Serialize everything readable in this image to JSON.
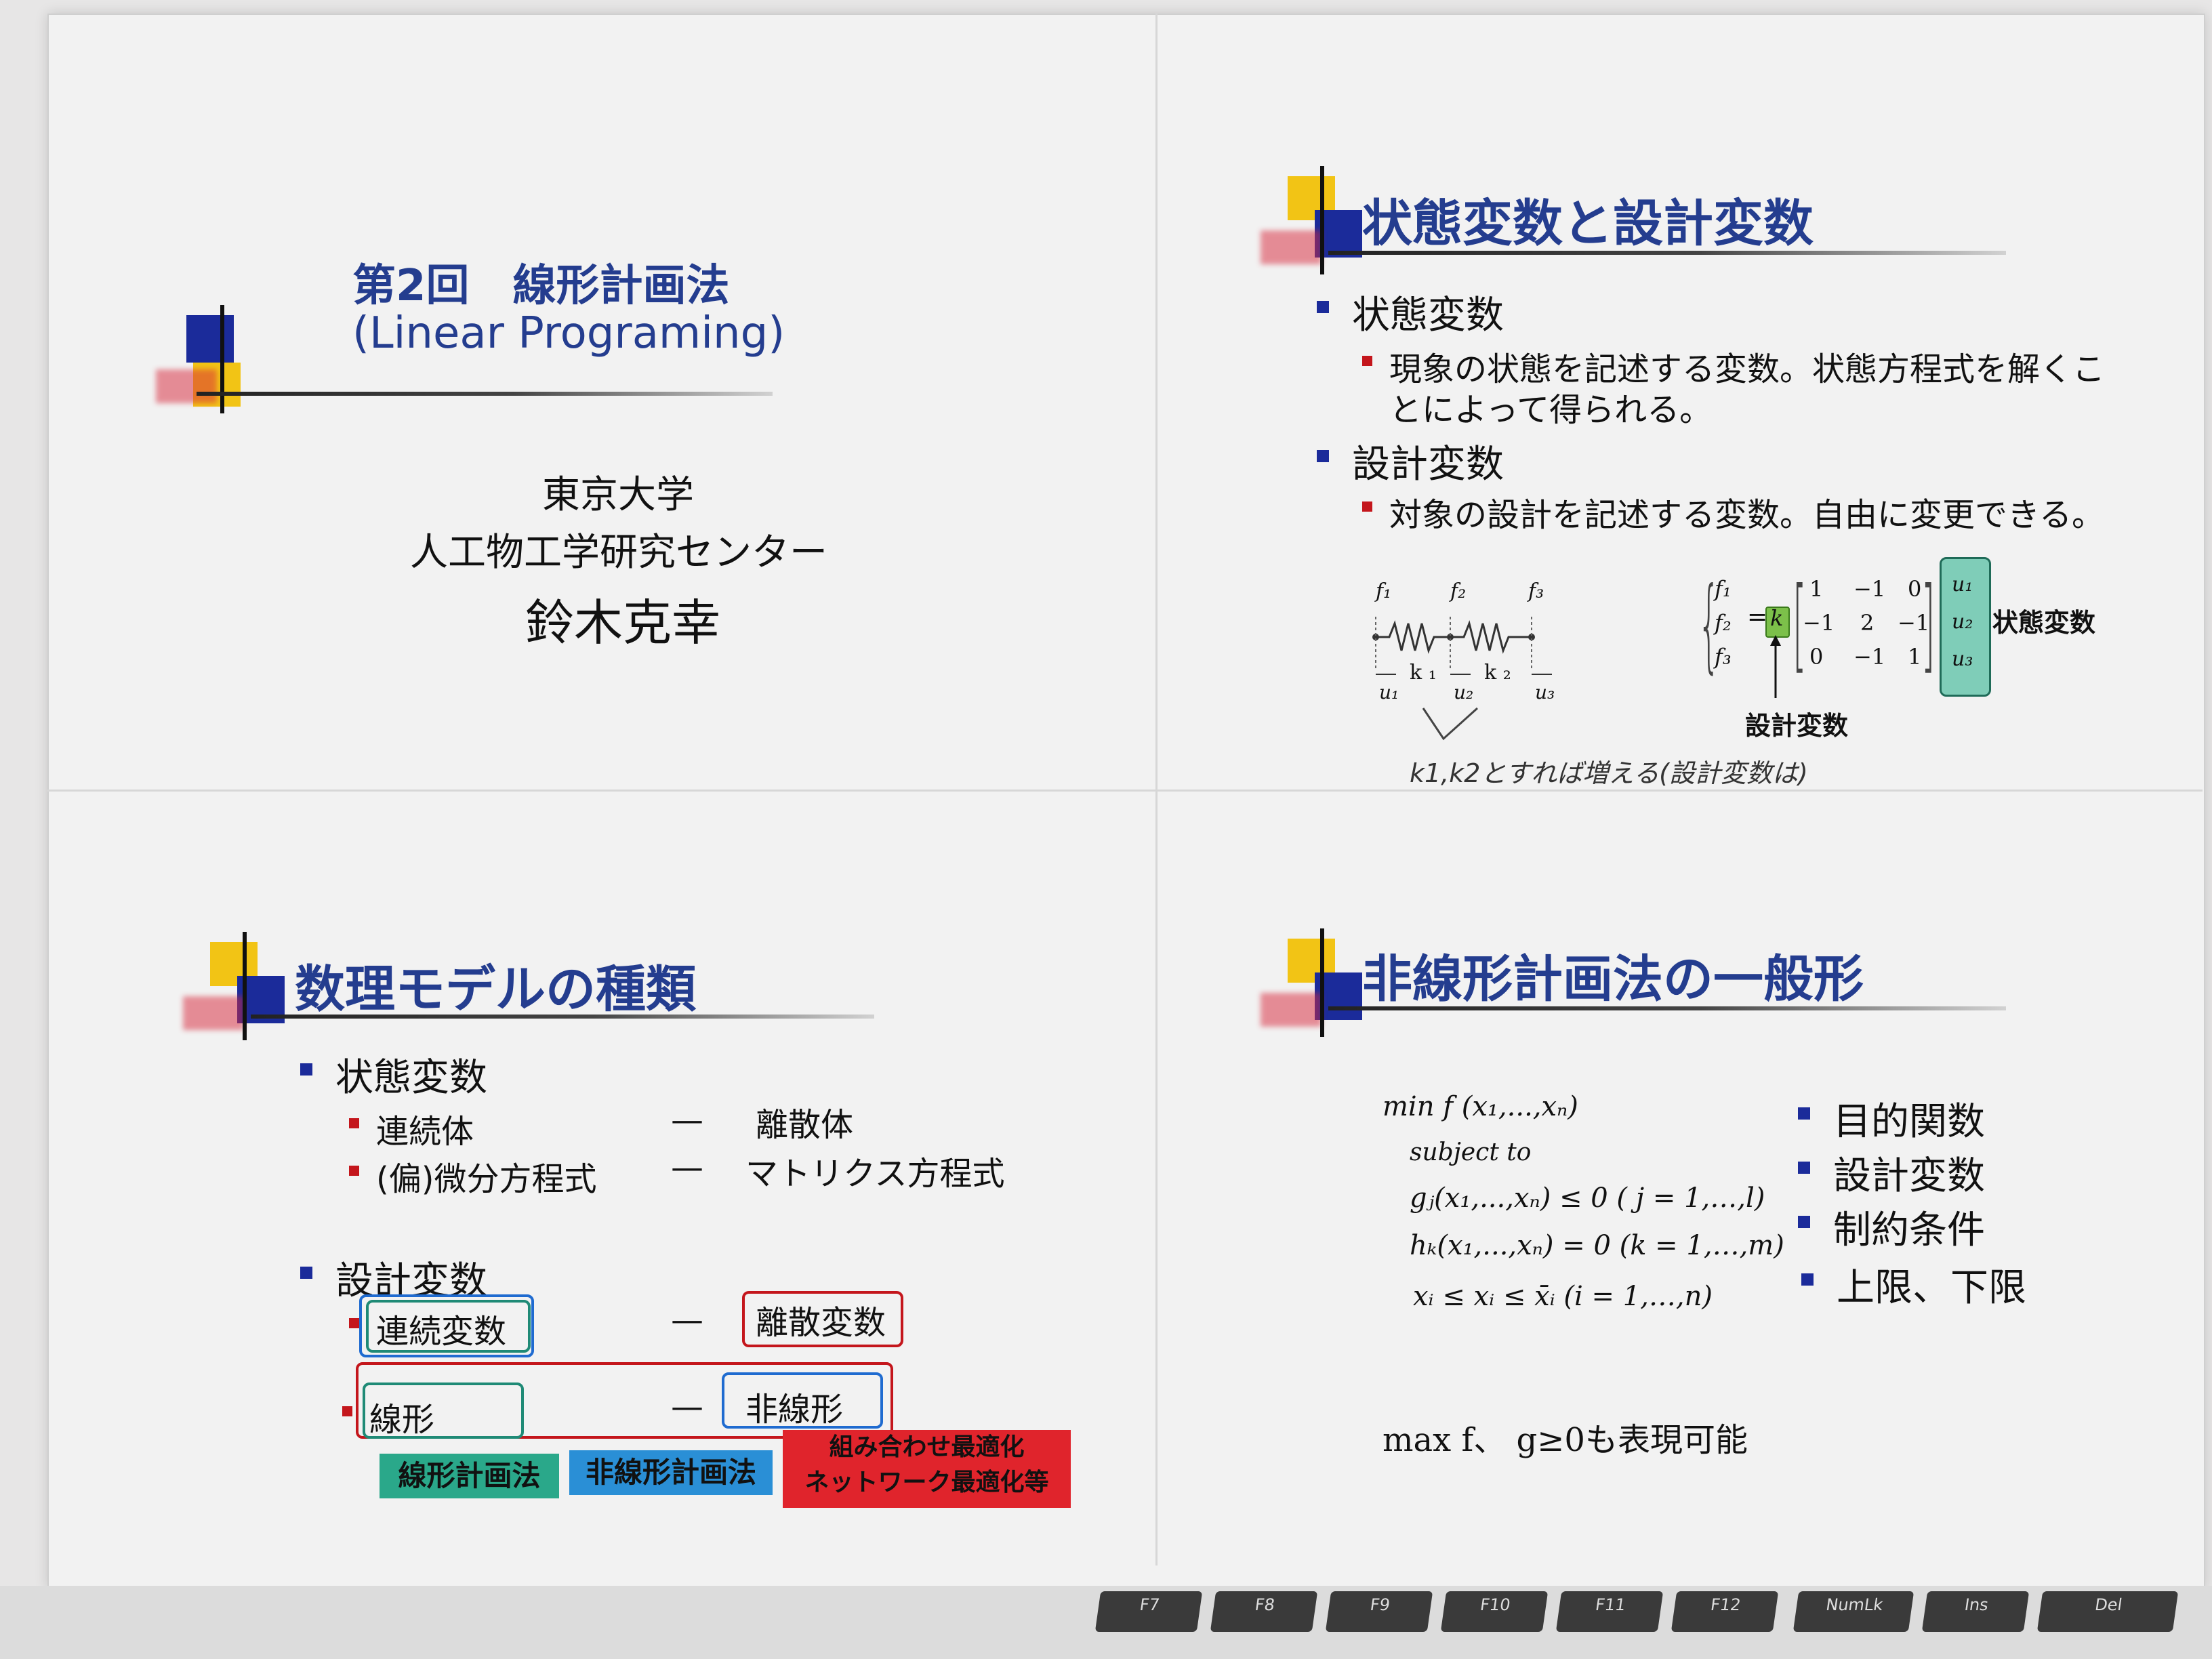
{
  "slide1": {
    "title_line1": "第2回　線形計画法",
    "title_line2": "(Linear Programing)",
    "affiliation1": "東京大学",
    "affiliation2": "人工物工学研究センター",
    "author": "鈴木克幸"
  },
  "slide2": {
    "title": "状態変数と設計変数",
    "bullet1": "状態変数",
    "sub1_line1": "現象の状態を記述する変数。状態方程式を解くこ",
    "sub1_line2": "とによって得られる。",
    "bullet2": "設計変数",
    "sub2": "対象の設計を記述する変数。自由に変更できる。",
    "spring_labels": {
      "f1": "f₁",
      "f2": "f₂",
      "f3": "f₃",
      "k1": "k ₁",
      "k2": "k ₂",
      "u1": "u₁",
      "u2": "u₂",
      "u3": "u₃"
    },
    "matrix": {
      "f_vec": [
        "f₁",
        "f₂",
        "f₃"
      ],
      "k": "k",
      "rows": [
        [
          "1",
          "−1",
          "0"
        ],
        [
          "−1",
          "2",
          "−1"
        ],
        [
          "0",
          "−1",
          "1"
        ]
      ],
      "u_vec": [
        "u₁",
        "u₂",
        "u₃"
      ],
      "state_label": "状態変数",
      "design_label": "設計変数"
    },
    "handwritten": "k1,k2とすれば増える(設計変数は)"
  },
  "slide3": {
    "title": "数理モデルの種類",
    "bullet1": "状態変数",
    "row1_left": "連続体",
    "row1_dash": "—",
    "row1_right": "離散体",
    "row2_left": "(偏)微分方程式",
    "row2_dash": "—",
    "row2_right": "マトリクス方程式",
    "bullet2": "設計変数",
    "row3_left": "連続変数",
    "row3_dash": "—",
    "row3_right": "離散変数",
    "row4_left": "線形",
    "row4_dash": "—",
    "row4_right": "非線形",
    "tag1": "線形計画法",
    "tag2": "非線形計画法",
    "tag3_line1": "組み合わせ最適化",
    "tag3_line2": "ネットワーク最適化等",
    "colors": {
      "tag1": "#2aa88a",
      "tag2": "#2a8fd6",
      "tag3": "#e0242c"
    }
  },
  "slide4": {
    "title": "非線形計画法の一般形",
    "eq1": "min f (x₁,...,xₙ)",
    "eq2": "subject to",
    "eq3": "gⱼ(x₁,...,xₙ) ≤ 0    ( j = 1,…,l)",
    "eq4": "hₖ(x₁,...,xₙ) = 0    (k = 1,…,m)",
    "eq5": "xᵢ ≤ xᵢ ≤ x̄ᵢ         (i = 1,…,n)",
    "legend": [
      "目的関数",
      "設計変数",
      "制約条件",
      "上限、下限"
    ],
    "note": "max f、 g≥0も表現可能"
  },
  "keyboard": [
    "F7",
    "F8",
    "F9",
    "F10",
    "F11",
    "F12",
    "NumLk",
    "Ins",
    "Del"
  ],
  "colors": {
    "heading": "#243d8f",
    "accent_blue": "#1b2b9a",
    "accent_yellow": "#f2c415",
    "accent_red": "#c4161c"
  }
}
